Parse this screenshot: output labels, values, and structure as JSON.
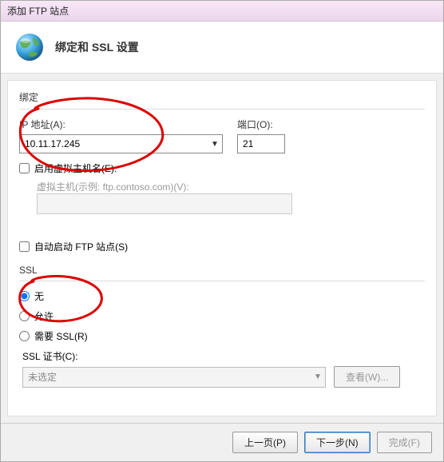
{
  "window": {
    "title": "添加 FTP 站点"
  },
  "header": {
    "title": "绑定和 SSL 设置"
  },
  "binding": {
    "group_label": "绑定",
    "ip_label": "IP 地址(A):",
    "ip_value": "10.11.17.245",
    "port_label": "端口(O):",
    "port_value": "21",
    "vhost_checkbox_label": "启用虚拟主机名(E):",
    "vhost_field_label": "虚拟主机(示例: ftp.contoso.com)(V):"
  },
  "autostart": {
    "label": "自动启动 FTP 站点(S)"
  },
  "ssl": {
    "group_label": "SSL",
    "opt_none": "无",
    "opt_allow": "允许",
    "opt_require": "需要 SSL(R)",
    "cert_label": "SSL 证书(C):",
    "cert_selected": "未选定",
    "view_btn": "查看(W)..."
  },
  "footer": {
    "prev": "上一页(P)",
    "next": "下一步(N)",
    "finish": "完成(F)"
  }
}
